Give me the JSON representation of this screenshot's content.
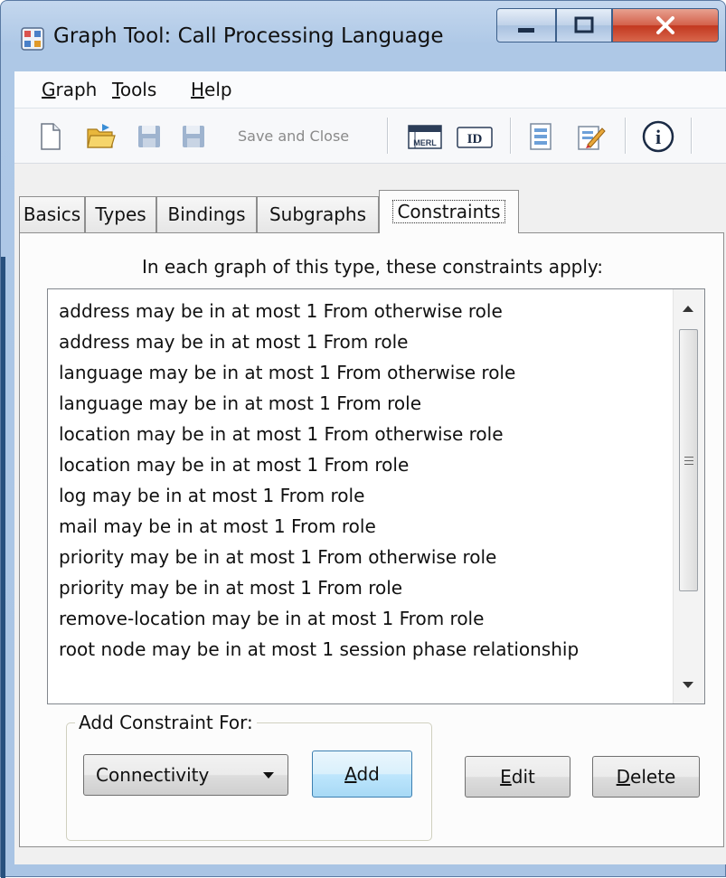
{
  "window": {
    "title": "Graph Tool: Call Processing Language"
  },
  "menu": {
    "items": [
      {
        "mnemonic": "G",
        "rest": "raph"
      },
      {
        "mnemonic": "T",
        "rest": "ools"
      },
      {
        "mnemonic": "H",
        "rest": "elp"
      }
    ]
  },
  "toolbar": {
    "icons": [
      "new-document-icon",
      "open-folder-icon",
      "save-icon",
      "save-and-close-icon",
      "merl-icon",
      "id-icon",
      "form-icon",
      "edit-note-icon",
      "info-icon"
    ],
    "save_and_close_label": "Save and Close",
    "merl_label": "MERL",
    "id_label": "ID",
    "info_label": "i"
  },
  "tabs": [
    {
      "label": "Basics",
      "active": false
    },
    {
      "label": "Types",
      "active": false
    },
    {
      "label": "Bindings",
      "active": false
    },
    {
      "label": "Subgraphs",
      "active": false
    },
    {
      "label": "Constraints",
      "active": true
    }
  ],
  "panel": {
    "prompt": "In each graph of this type, these constraints apply:"
  },
  "constraints": [
    "address may be in at most 1 From otherwise role",
    "address may be in at most 1 From role",
    "language may be in at most 1 From otherwise role",
    "language may be in at most 1 From role",
    "location may be in at most 1 From otherwise role",
    "location may be in at most 1 From role",
    "log may be in at most 1 From role",
    "mail may be in at most 1 From role",
    "priority may be in at most 1 From otherwise role",
    "priority may be in at most 1 From role",
    "remove-location may be in at most 1 From role",
    "root node may be in at most 1 session phase relationship"
  ],
  "add_group": {
    "label": "Add Constraint For:",
    "selected": "Connectivity",
    "add": {
      "mnemonic": "A",
      "rest": "dd"
    }
  },
  "actions": {
    "edit": {
      "mnemonic": "E",
      "rest": "dit"
    },
    "delete": {
      "mnemonic": "D",
      "rest": "elete"
    }
  },
  "colors": {
    "window_frame": "#a9c4e4",
    "close_button": "#c2371f",
    "focus_button": "#3c7fb1"
  }
}
